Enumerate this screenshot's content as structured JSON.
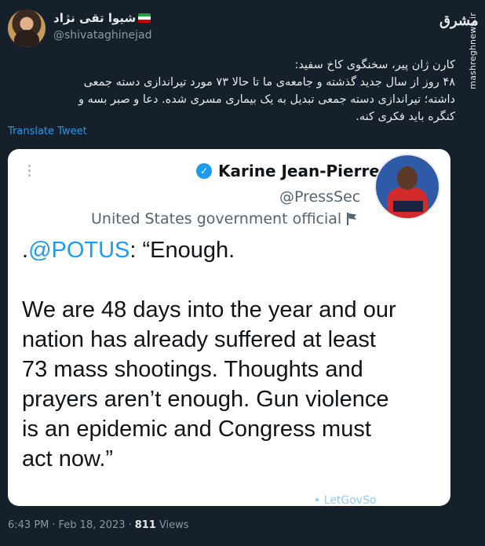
{
  "author": {
    "name": "شیوا تقی نژاد",
    "handle": "@shivataghinejad",
    "flag_colors": [
      "#239f40",
      "#ffffff",
      "#da0000"
    ]
  },
  "watermark": {
    "mark": "مشرق",
    "site": "mashreghnews.ir"
  },
  "tweet": {
    "lines": [
      "کارن ژان پیر، سخنگوی کاخ سفید:",
      "۴۸ روز از سال جدید گذشته و جامعه‌ی ما تا حالا ۷۳ مورد تیراندازی دسته جمعی",
      "داشته؛ تیراندازی دسته جمعی تبدیل به یک بیماری مسری شده. دعا و صبر بسه و",
      "کنگره باید فکری کنه."
    ],
    "translate_label": "Translate Tweet"
  },
  "quoted": {
    "name": "Karine Jean-Pierre",
    "handle": "@PressSec",
    "label": "United States government official",
    "mention": "@POTUS",
    "line1_prefix": ".",
    "line1_suffix": ": “Enough.",
    "body_lines": [
      "We are 48 days into the year and our",
      "nation has already suffered at least",
      "73 mass shootings. Thoughts and",
      "prayers aren’t enough. Gun violence",
      "is an epidemic and Congress must",
      "act now.”"
    ],
    "footer_fragment": "• LetGovSo"
  },
  "meta": {
    "time": "6:43 PM",
    "separator": "·",
    "date": "Feb 18, 2023",
    "views_count": "811",
    "views_label": "Views"
  },
  "colors": {
    "background": "#15202b",
    "link": "#1d9bf0",
    "secondary_text": "#8b98a5"
  }
}
